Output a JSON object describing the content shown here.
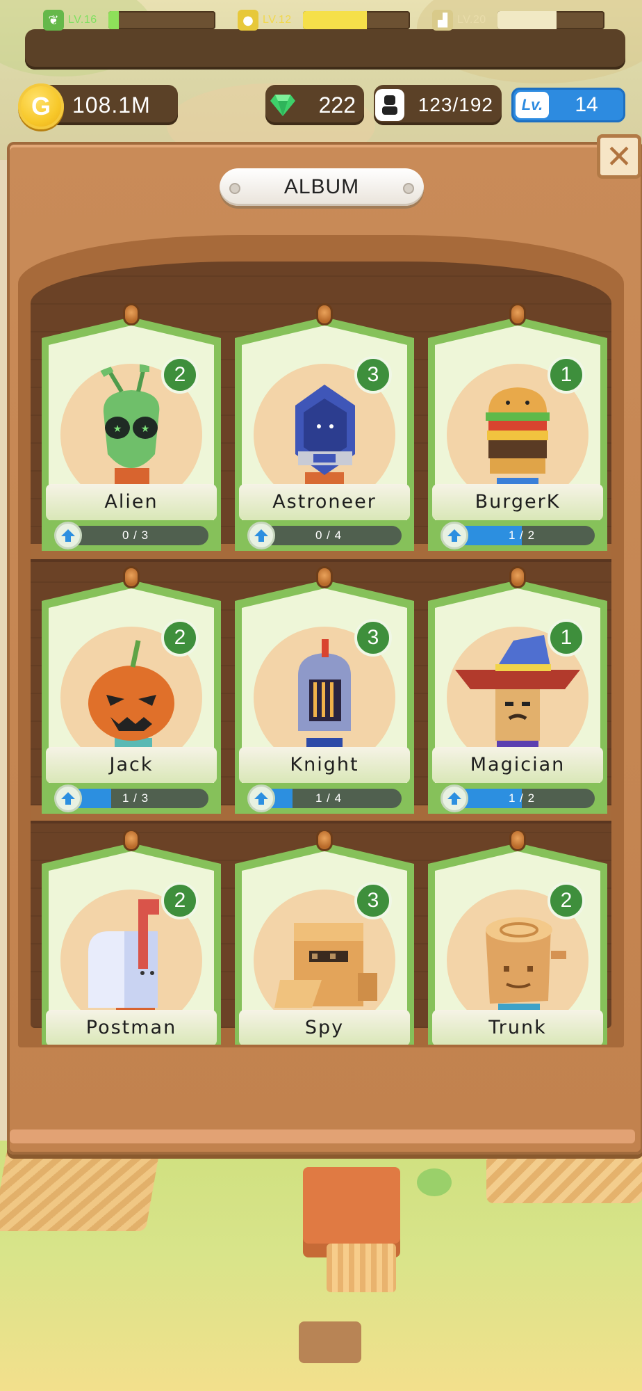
{
  "hud": {
    "stats": [
      {
        "icon": "leaf-icon",
        "level": "LV.16",
        "progress": 0.1,
        "color": "#8ee05a",
        "icon_bg": "#65b84a",
        "text_color": "#7ee05f"
      },
      {
        "icon": "money-bag-icon",
        "level": "LV.12",
        "progress": 0.6,
        "color": "#f5e04a",
        "icon_bg": "#e7c83a",
        "text_color": "#f1d84a"
      },
      {
        "icon": "factory-icon",
        "level": "LV.20",
        "progress": 0.55,
        "color": "#f1e9c4",
        "icon_bg": "#d9ca8a",
        "text_color": "#e9dcaa"
      }
    ],
    "coin_symbol": "G",
    "coins": "108.1M",
    "gems": "222",
    "population": "123/192",
    "level_label": "Lv.",
    "level": "14"
  },
  "album": {
    "title": "ALBUM",
    "close_label": "✕",
    "cards": [
      {
        "name": "Alien",
        "count": "2",
        "progress_text": "0 / 3",
        "progress": 0.0,
        "character": "alien"
      },
      {
        "name": "Astroneer",
        "count": "3",
        "progress_text": "0 / 4",
        "progress": 0.0,
        "character": "astronaut"
      },
      {
        "name": "BurgerK",
        "count": "1",
        "progress_text": "1 / 2",
        "progress": 0.5,
        "character": "burger"
      },
      {
        "name": "Jack",
        "count": "2",
        "progress_text": "1 / 3",
        "progress": 0.333,
        "character": "pumpkin"
      },
      {
        "name": "Knight",
        "count": "3",
        "progress_text": "1 / 4",
        "progress": 0.25,
        "character": "knight"
      },
      {
        "name": "Magician",
        "count": "1",
        "progress_text": "1 / 2",
        "progress": 0.5,
        "character": "wizard"
      },
      {
        "name": "Postman",
        "count": "2",
        "progress_text": "",
        "progress": 0.0,
        "character": "mailbox"
      },
      {
        "name": "Spy",
        "count": "3",
        "progress_text": "",
        "progress": 0.0,
        "character": "box"
      },
      {
        "name": "Trunk",
        "count": "2",
        "progress_text": "",
        "progress": 0.0,
        "character": "stump"
      }
    ]
  }
}
